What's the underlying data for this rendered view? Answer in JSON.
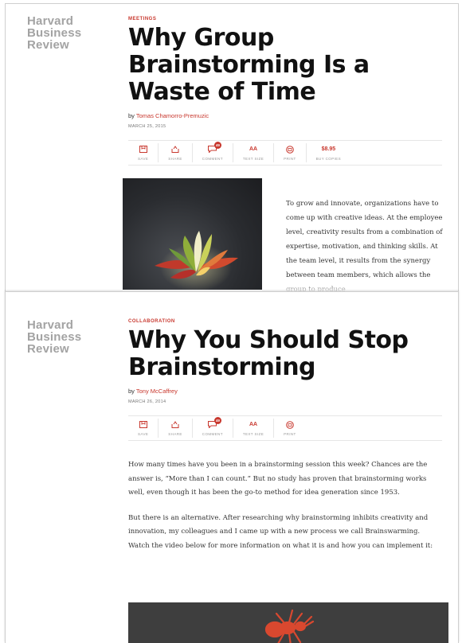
{
  "article1": {
    "logo": [
      "Harvard",
      "Business",
      "Review"
    ],
    "topic": "MEETINGS",
    "title": "Why Group Brainstorming Is a Waste of Time",
    "by": "by ",
    "author": "Tomas Chamorro-Premuzic",
    "date": "MARCH 25, 2015",
    "tools": [
      {
        "icon": "save-icon",
        "label": "SAVE"
      },
      {
        "icon": "share-icon",
        "label": "SHARE"
      },
      {
        "icon": "comment-icon",
        "label": "COMMENT",
        "badge": "49"
      },
      {
        "icon": "text-size-icon",
        "label": "TEXT SIZE",
        "glyph": "AA"
      },
      {
        "icon": "print-icon",
        "label": "PRINT"
      },
      {
        "icon": "price-icon",
        "label": "BUY COPIES",
        "price": "$8.95"
      }
    ],
    "side_text": "To grow and innovate, organizations have to come up with creative ideas. At the employee level, creativity results from a combination of expertise, motivation, and thinking skills. At the team level, it results from the synergy between team members, which allows the group to produce"
  },
  "article2": {
    "logo": [
      "Harvard",
      "Business",
      "Review"
    ],
    "topic": "COLLABORATION",
    "title": "Why You Should Stop Brainstorming",
    "by": "by ",
    "author": "Tony McCaffrey",
    "date": "MARCH 26, 2014",
    "tools": [
      {
        "icon": "save-icon",
        "label": "SAVE"
      },
      {
        "icon": "share-icon",
        "label": "SHARE"
      },
      {
        "icon": "comment-icon",
        "label": "COMMENT",
        "badge": "49"
      },
      {
        "icon": "text-size-icon",
        "label": "TEXT SIZE",
        "glyph": "AA"
      },
      {
        "icon": "print-icon",
        "label": "PRINT"
      }
    ],
    "paragraphs": [
      "How many times have you been in a brainstorming session this week? Chances are the answer is, “More than I can count.” But no study has proven that brainstorming works well, even though it has been the go-to method for idea generation since 1953.",
      "But there is an alternative. After researching why brainstorming inhibits creativity and innovation, my colleagues and I came up with a new process we call Brainswarming. Watch the video below for more information on what it is and how you can implement it:"
    ]
  },
  "colors": {
    "accent": "#c8372d",
    "logo": "#a3a3a3",
    "video_bg": "#3e3e3e",
    "ant": "#d9482f"
  }
}
